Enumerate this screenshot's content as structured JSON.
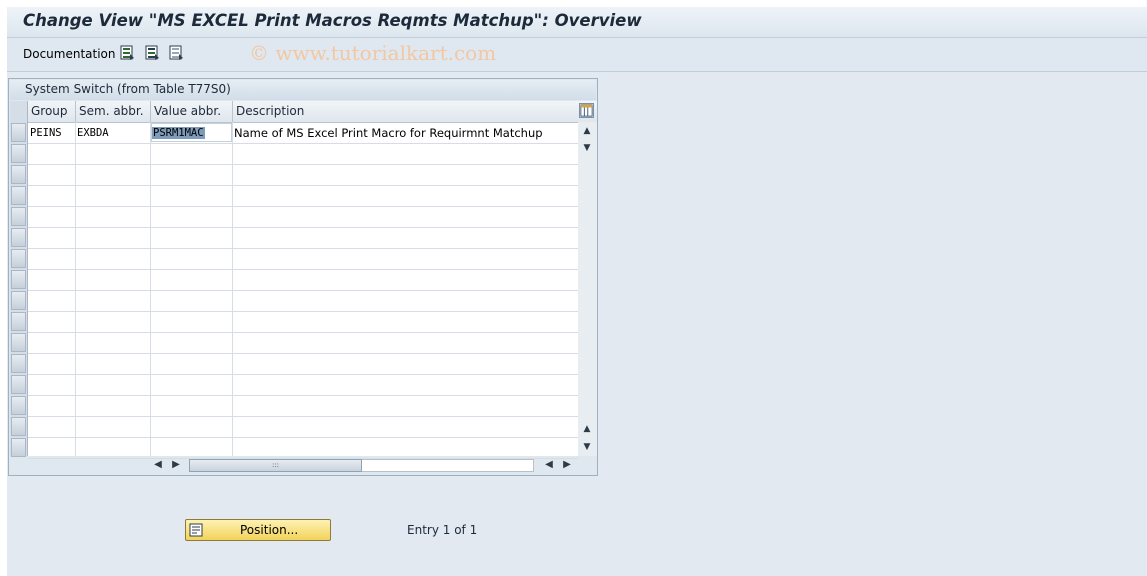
{
  "window": {
    "title": "Change View \"MS EXCEL Print Macros Reqmts Matchup\": Overview"
  },
  "toolbar": {
    "documentation_label": "Documentation",
    "icons": [
      "select-all-icon",
      "select-block-icon",
      "deselect-all-icon"
    ],
    "watermark": "© www.tutorialkart.com"
  },
  "table": {
    "title": "System Switch (from Table T77S0)",
    "columns": [
      "Group",
      "Sem. abbr.",
      "Value abbr.",
      "Description"
    ],
    "rows": [
      {
        "group": "PEINS",
        "sem_abbr": "EXBDA",
        "value_abbr": "PSRM1MAC",
        "description": "Name of MS Excel Print Macro for Requirmnt Matchup"
      }
    ],
    "empty_rows": 15
  },
  "footer": {
    "position_button": "Position...",
    "entry_text": "Entry 1 of 1"
  },
  "colors": {
    "accent_button": "#f2d35a",
    "workarea": "#e2e9f1",
    "selection_highlight": "#7d9bbb"
  }
}
